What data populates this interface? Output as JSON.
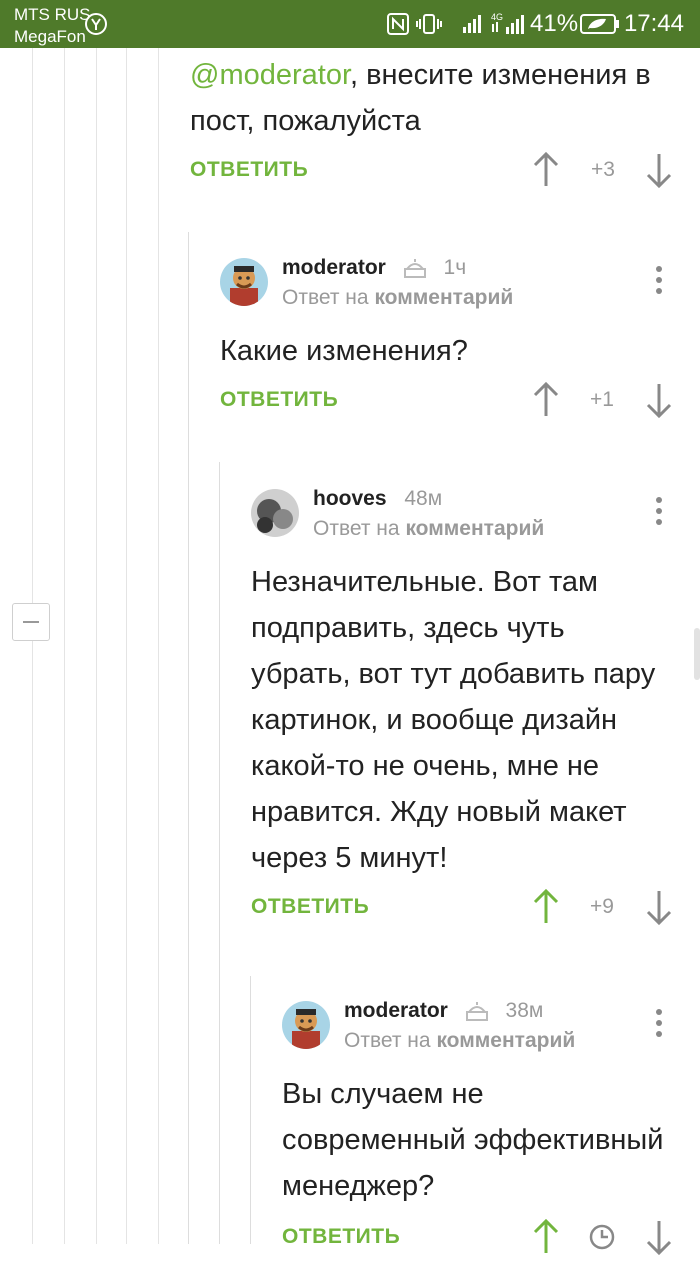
{
  "status_bar": {
    "carrier_line1": "MTS RUS",
    "carrier_line2": "MegaFon",
    "battery_pct": "41%",
    "time": "17:44"
  },
  "comments": [
    {
      "id": "c1",
      "mention": "@moderator",
      "text": ", внесите изменения в пост, пожалуйста",
      "reply_label": "ОТВЕТИТЬ",
      "score": "+3"
    },
    {
      "id": "c2",
      "author": "moderator",
      "time": "1ч",
      "sub_prefix": "Ответ на",
      "sub_link": "комментарий",
      "text": "Какие изменения?",
      "reply_label": "ОТВЕТИТЬ",
      "score": "+1"
    },
    {
      "id": "c3",
      "author": "hooves",
      "time": "48м",
      "sub_prefix": "Ответ на",
      "sub_link": "комментарий",
      "text": "Незначительные. Вот там подправить, здесь чуть убрать, вот тут добавить пару картинок, и вообще дизайн какой-то не очень, мне не нравится. Жду новый макет через 5 минут!",
      "reply_label": "ОТВЕТИТЬ",
      "score": "+9"
    },
    {
      "id": "c4",
      "author": "moderator",
      "time": "38м",
      "sub_prefix": "Ответ на",
      "sub_link": "комментарий",
      "text": "Вы случаем не современный эффективный менеджер?",
      "reply_label": "ОТВЕТИТЬ"
    }
  ],
  "colors": {
    "status_bar": "#4f7a2a",
    "accent": "#72b53d",
    "upvoted": "#72b53d"
  }
}
